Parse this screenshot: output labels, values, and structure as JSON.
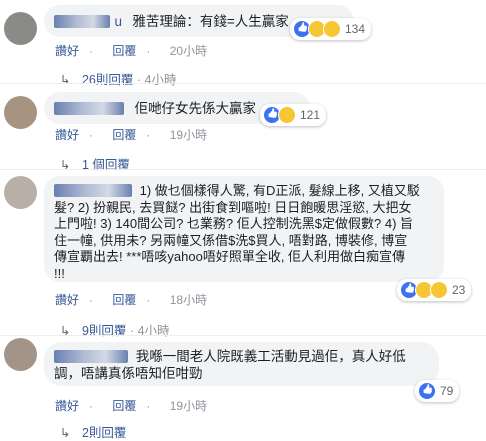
{
  "comments": [
    {
      "name_tail": "u",
      "text": "雅苦理論：有錢=人生贏家",
      "reaction_count": "134",
      "like": "讚好",
      "reply": "回覆",
      "time": "20小時"
    },
    {
      "name_tail": "",
      "text": "佢哋仔女先係大贏家",
      "reaction_count": "121",
      "like": "讚好",
      "reply": "回覆",
      "time": "19小時"
    },
    {
      "name_tail": "",
      "text_lines": [
        "1) 做乜個樣得人驚, 有D正派, 髮線上移, 又植又駁",
        "髮? 2) 扮親民, 去買餸? 出街食到嘔啦! 日日飽暖思淫慾, 大把女",
        "上門啦! 3) 140間公司? 乜業務? 佢人控制洗黑$定做假數? 4) 旨",
        "住一幢, 供用未? 另兩幢又係借$洗$買人, 唔對路, 博裝修, 博宣",
        "傳宣覇出去! ***唔咳yahoo唔好照單全收, 佢人利用做白痴宣傳",
        "!!!"
      ],
      "reaction_count": "23",
      "like": "讚好",
      "reply": "回覆",
      "time": "18小時"
    },
    {
      "name_tail": "",
      "text_lines": [
        "我喺一間老人院既義工活動見過佢，真人好低",
        "調，唔講真係唔知佢咁勁"
      ],
      "reaction_count": "79",
      "like": "讚好",
      "reply": "回覆",
      "time": "19小時"
    }
  ],
  "reply_rows": [
    {
      "label": "26則回覆",
      "time": "4小時"
    },
    {
      "label": "1 個回覆",
      "time": ""
    },
    {
      "label": "9則回覆",
      "time": "4小時"
    },
    {
      "label": "2則回覆",
      "time": ""
    }
  ],
  "separator": "·"
}
